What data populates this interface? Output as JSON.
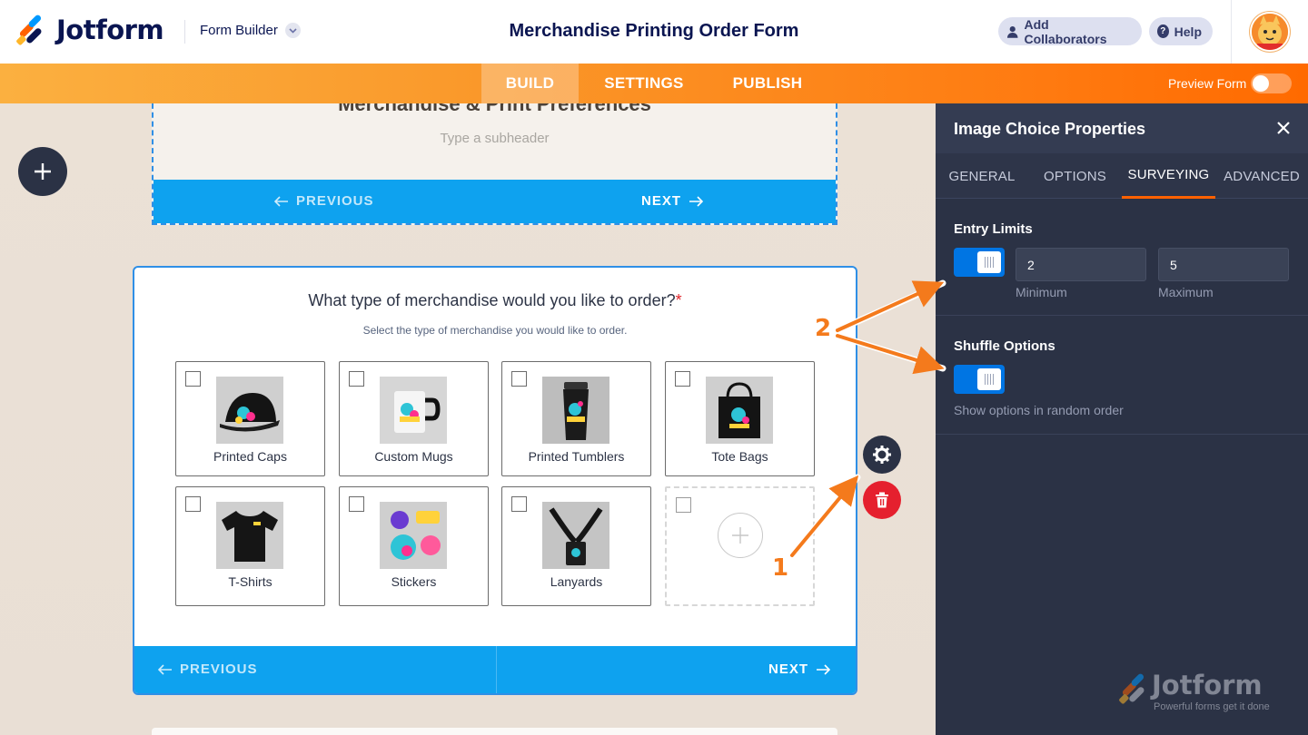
{
  "header": {
    "brand": "Jotform",
    "builder_label": "Form Builder",
    "form_title": "Merchandise Printing Order Form",
    "collab_label": "Add Collaborators",
    "help_label": "Help"
  },
  "nav": {
    "tabs": [
      "BUILD",
      "SETTINGS",
      "PUBLISH"
    ],
    "active_tab": "BUILD",
    "preview_label": "Preview Form",
    "preview_on": false
  },
  "canvas": {
    "page_heading": "Merchandise & Print Preferences",
    "subheader_placeholder": "Type a subheader",
    "prev_label": "PREVIOUS",
    "next_label": "NEXT",
    "question": "What type of merchandise would you like to order?",
    "required_mark": "*",
    "question_desc": "Select the type of merchandise you would like to order.",
    "options": [
      {
        "label": "Printed Caps",
        "icon": "cap-image"
      },
      {
        "label": "Custom Mugs",
        "icon": "mug-image"
      },
      {
        "label": "Printed Tumblers",
        "icon": "tumbler-image"
      },
      {
        "label": "Tote Bags",
        "icon": "tote-bag-image"
      },
      {
        "label": "T-Shirts",
        "icon": "tshirt-image"
      },
      {
        "label": "Stickers",
        "icon": "stickers-image"
      },
      {
        "label": "Lanyards",
        "icon": "lanyard-image"
      }
    ]
  },
  "panel": {
    "title": "Image Choice Properties",
    "tabs": [
      "GENERAL",
      "OPTIONS",
      "SURVEYING",
      "ADVANCED"
    ],
    "active_tab": "SURVEYING",
    "entry_limits": {
      "label": "Entry Limits",
      "enabled": true,
      "minimum": "2",
      "maximum": "5",
      "minimum_label": "Minimum",
      "maximum_label": "Maximum"
    },
    "shuffle": {
      "label": "Shuffle Options",
      "enabled": true,
      "hint": "Show options in random order"
    }
  },
  "watermark": {
    "brand": "Jotform",
    "tagline": "Powerful forms get it done"
  },
  "annotations": [
    "1",
    "2"
  ],
  "colors": {
    "accent_orange": "#ff6100",
    "nav_blue": "#0ea2ef",
    "toggle_blue": "#0075e3",
    "panel_bg": "#2b3245",
    "annotation": "#f47a1c"
  }
}
